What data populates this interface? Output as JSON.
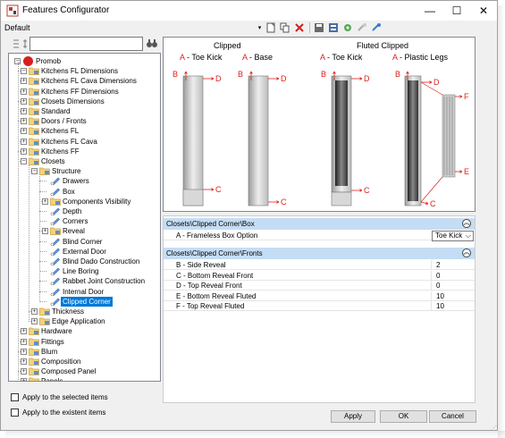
{
  "window": {
    "title": "Features Configurator",
    "controls": {
      "minimize": "—",
      "maximize": "☐",
      "close": "✕"
    }
  },
  "toolbar": {
    "config_label": "Default"
  },
  "tree": {
    "root": "Promob",
    "items": [
      {
        "label": "Kitchens FL Dimensions"
      },
      {
        "label": "Kitchens FL Cava Dimensions"
      },
      {
        "label": "Kitchens FF Dimensions"
      },
      {
        "label": "Closets Dimensions"
      },
      {
        "label": "Standard"
      },
      {
        "label": "Doors / Fronts"
      },
      {
        "label": "Kitchens FL"
      },
      {
        "label": "Kitchens FL Cava"
      },
      {
        "label": "Kitchens FF"
      },
      {
        "label": "Closets"
      },
      {
        "label": "Structure"
      },
      {
        "label": "Drawers"
      },
      {
        "label": "Box"
      },
      {
        "label": "Components Visibility"
      },
      {
        "label": "Depth"
      },
      {
        "label": "Corners"
      },
      {
        "label": "Reveal"
      },
      {
        "label": "Blind Corner"
      },
      {
        "label": "External Door"
      },
      {
        "label": "Blind Dado Construction"
      },
      {
        "label": "Line Boring"
      },
      {
        "label": "Rabbet Joint Construction"
      },
      {
        "label": "Internal Door"
      },
      {
        "label": "Clipped Corner"
      },
      {
        "label": "Thickness"
      },
      {
        "label": "Edge Application"
      },
      {
        "label": "Hardware"
      },
      {
        "label": "Fittings"
      },
      {
        "label": "Blum"
      },
      {
        "label": "Composition"
      },
      {
        "label": "Composed Panel"
      },
      {
        "label": "Panels"
      }
    ]
  },
  "options": {
    "apply_selected": "Apply to the selected items",
    "apply_existent": "Apply to the existent items"
  },
  "preview": {
    "clipped_title": "Clipped",
    "fluted_title": "Fluted Clipped",
    "panels": [
      {
        "letter": "A",
        "label": " - Toe Kick"
      },
      {
        "letter": "A",
        "label": " - Base"
      },
      {
        "letter": "A",
        "label": " - Toe Kick"
      },
      {
        "letter": "A",
        "label": " - Plastic Legs"
      }
    ],
    "marker_labels": {
      "b": "B",
      "c": "C",
      "d": "D",
      "e": "E",
      "f": "F"
    },
    "accent": "#e0201b"
  },
  "properties": {
    "group1": {
      "title": "Closets\\Clipped Corner\\Box",
      "rows": [
        {
          "name": "A - Frameless Box Option",
          "value": "Toe Kick"
        }
      ]
    },
    "group2": {
      "title": "Closets\\Clipped Corner\\Fronts",
      "rows": [
        {
          "name": "B - Side Reveal",
          "value": "2"
        },
        {
          "name": "C - Bottom Reveal Front",
          "value": "0"
        },
        {
          "name": "D - Top Reveal Front",
          "value": "0"
        },
        {
          "name": "E - Bottom Reveal Fluted",
          "value": "10"
        },
        {
          "name": "F - Top Reveal Fluted",
          "value": "10"
        }
      ]
    },
    "collapse_glyph": "︽"
  },
  "buttons": {
    "apply": "Apply",
    "ok": "OK",
    "cancel": "Cancel"
  }
}
